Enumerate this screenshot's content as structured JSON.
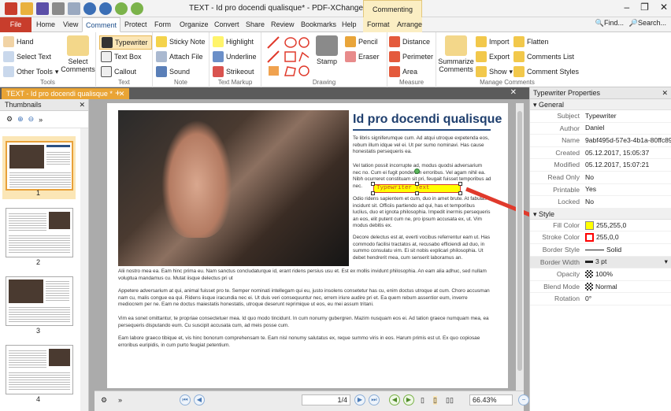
{
  "titlebar": {
    "title": "TEXT - Id pro docendi qualisque* - PDF-XChange Editor",
    "context_group": "Commenting Tools"
  },
  "tabs": {
    "file": "File",
    "items": [
      "Home",
      "View",
      "Comment",
      "Protect",
      "Form",
      "Organize",
      "Convert",
      "Share",
      "Review",
      "Bookmarks",
      "Help",
      "Format",
      "Arrange"
    ],
    "active": "Comment",
    "find": "Find...",
    "search": "Search..."
  },
  "ribbon": {
    "tools": {
      "label": "Tools",
      "hand": "Hand",
      "select_text": "Select Text",
      "other_tools": "Other Tools",
      "select_comments": "Select Comments"
    },
    "text": {
      "label": "Text",
      "typewriter": "Typewriter",
      "text_box": "Text Box",
      "callout": "Callout"
    },
    "note": {
      "label": "Note",
      "sticky_note": "Sticky Note",
      "attach_file": "Attach File",
      "sound": "Sound"
    },
    "markup": {
      "label": "Text Markup",
      "highlight": "Highlight",
      "underline": "Underline",
      "strikeout": "Strikeout"
    },
    "drawing": {
      "label": "Drawing",
      "pencil": "Pencil",
      "eraser": "Eraser",
      "stamp": "Stamp"
    },
    "measure": {
      "label": "Measure",
      "distance": "Distance",
      "perimeter": "Perimeter",
      "area": "Area"
    },
    "manage": {
      "label": "Manage Comments",
      "summarize": "Summarize Comments",
      "import": "Import",
      "export": "Export",
      "show": "Show",
      "flatten": "Flatten",
      "comments_list": "Comments List",
      "comment_styles": "Comment Styles"
    }
  },
  "doctab": {
    "title": "TEXT - Id pro docendi qualisque *"
  },
  "thumbnails": {
    "title": "Thumbnails",
    "pages": [
      "1",
      "2",
      "3",
      "4"
    ]
  },
  "page": {
    "heading": "Id pro docendi qualisque",
    "col1": "Te libris signiferumque cum. Ad atqui utroque expetenda eos, rebum illum idque vel ei. Ut per sumo nominavi. Has cause honestatis persequeris ea.",
    "col2": "Vel tation possit incorrupte ad, modus quodsi adversarium nec no. Cum ei fugit ponderum erroribus. Vel agam nihil ea. Nibh ocurreret constituam sit pri, feugait fuisset temporibus ad nec.",
    "col3": "Odio ridens sapientem et cum, duo in amet brute. At fabulas incidunt sit. Officiis partiendo ad qui, has et temporibus luclius, duo et ignota philosophia. Impedit inermis persequeris an eos, elit putent cum ne, pro ipsum accusata ex, ut. Vim modus debitis ex.",
    "col4": "Decore delectus est at, everti vocibus referrentur eam ut. Has commodo facilisi tractatos at, recusabo efficiendi ad duo, in summo consulatu vim. Ei sit nobis explicari philosophia. Ut debet hendrerit mea, cum senserit laboramus an.",
    "para1": "Alii nostro mea ea. Eam hinc prima eu. Nam sanctus concludaturque id, erant ridens persius usu et. Est ex mollis invidunt philosophia. An eam alia adhuc, sed nullam voluptua mandamus cu. Mutat iisque delectus pri ut",
    "para2": "Appetere adversarium at qui, animal fuisset pro te. Semper nominati intellegam qui eu, justo insolens consetetur has cu, enim doctus utroque at cum. Choro accusman nam cu, malis congue ea qui. Ridens iisque iracundia nec ei. Ut duis veri consequuntur nec, errem iriure audire pri et. Ea quem rebum assentior eum, inverre mediocrem per ne. Eam ne doctus maiestatis honestatis, utroque deserunt reprimique ut eos, eu mei assum tritani.",
    "para3": "Vim ea sonet omittantur, te propriae consectetuer mea. Id quo modo tincidunt. In cum nonumy gubergren. Mazim nusquam eos ei. Ad tation graece numquam mea, ea persequeris disputando eum. Cu suscipit accusata cum, ad meis posse cum.",
    "para4": "Eam labore graeco tibique et, vis hinc bonorum comprehensam te. Eam nisl nonumy salutatus ex, reque summo viris in eos. Harum primis est ut. Ex quo copiosae erroribus euripidis, in cum purto feugiat petentium.",
    "typewriter_text": "Typewriter Text"
  },
  "status": {
    "page_value": "1/4",
    "zoom": "66.43%"
  },
  "props": {
    "title": "Typewriter Properties",
    "general": "General",
    "subject_k": "Subject",
    "subject_v": "Typewriter",
    "author_k": "Author",
    "author_v": "Daniel",
    "name_k": "Name",
    "name_v": "9abf495d-57e3-4b1a-80ffc89...",
    "created_k": "Created",
    "created_v": "05.12.2017, 15:05:37",
    "modified_k": "Modified",
    "modified_v": "05.12.2017, 15:07:21",
    "readonly_k": "Read Only",
    "readonly_v": "No",
    "printable_k": "Printable",
    "printable_v": "Yes",
    "locked_k": "Locked",
    "locked_v": "No",
    "style": "Style",
    "fill_k": "Fill Color",
    "fill_v": "255,255,0",
    "fill_color": "#ffff00",
    "stroke_k": "Stroke Color",
    "stroke_v": "255,0,0",
    "stroke_color": "#ff0000",
    "border_style_k": "Border Style",
    "border_style_v": "Solid",
    "border_width_k": "Border Width",
    "border_width_v": "3 pt",
    "opacity_k": "Opacity",
    "opacity_v": "100%",
    "blend_k": "Blend Mode",
    "blend_v": "Normal",
    "rotation_k": "Rotation",
    "rotation_v": "0°"
  }
}
